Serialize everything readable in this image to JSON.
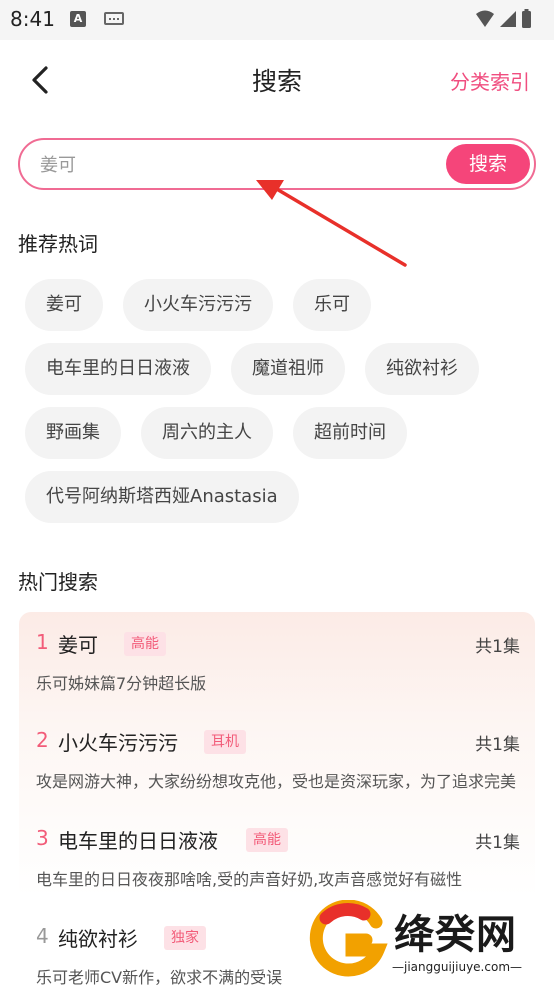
{
  "status_bar": {
    "time": "8:41",
    "notification_icons": [
      "a-icon",
      "keyboard-icon"
    ],
    "system_icons": [
      "wifi-icon",
      "signal-icon",
      "battery-icon"
    ]
  },
  "header": {
    "title": "搜索",
    "category_link": "分类索引"
  },
  "search": {
    "placeholder": "姜可",
    "button_label": "搜索"
  },
  "recommended": {
    "title": "推荐热词",
    "tags": [
      [
        "姜可",
        "小火车污污污",
        "乐可"
      ],
      [
        "电车里的日日液液",
        "魔道祖师",
        "纯欲衬衫"
      ],
      [
        "野画集",
        "周六的主人",
        "超前时间"
      ],
      [
        "代号阿纳斯塔西娅Anastasia"
      ]
    ]
  },
  "hot": {
    "title": "热门搜索",
    "items": [
      {
        "rank": "1",
        "name": "姜可",
        "badge": "高能",
        "count": "共1集",
        "desc": "乐可姊妹篇7分钟超长版"
      },
      {
        "rank": "2",
        "name": "小火车污污污",
        "badge": "耳机",
        "count": "共1集",
        "desc": "攻是网游大神，大家纷纷想攻克他，受也是资深玩家，为了追求完美"
      },
      {
        "rank": "3",
        "name": "电车里的日日液液",
        "badge": "高能",
        "count": "共1集",
        "desc": "电车里的日日夜夜那啥啥,受的声音好奶,攻声音感觉好有磁性"
      },
      {
        "rank": "4",
        "name": "纯欲衬衫",
        "badge": "独家",
        "count": "",
        "desc": "乐可老师CV新作，欲求不满的受误"
      }
    ]
  },
  "watermark": {
    "brand": "绛癸网",
    "url": "—jiangguijiuye.com—"
  },
  "colors": {
    "accent": "#f5457a",
    "accent_text": "#f04d7f",
    "rank_top": "#f25c79",
    "badge_bg": "#fde1e6"
  }
}
